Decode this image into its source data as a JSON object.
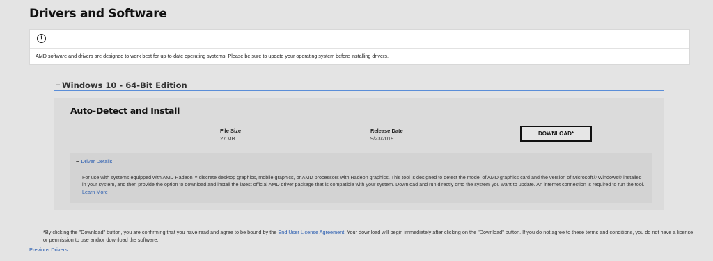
{
  "page": {
    "title": "Drivers and Software"
  },
  "notice": {
    "icon": "exclamation-circle-icon",
    "text": "AMD software and drivers are designed to work best for up-to-date operating systems. Please be sure to update your operating system before installing drivers."
  },
  "os_section": {
    "toggle": "−",
    "title": "Windows 10 - 64-Bit Edition"
  },
  "auto_detect": {
    "title": "Auto-Detect and Install",
    "file_size_label": "File Size",
    "file_size_value": "27 MB",
    "release_date_label": "Release Date",
    "release_date_value": "9/23/2019",
    "download_label": "DOWNLOAD*"
  },
  "driver_details": {
    "toggle": "−",
    "label": "Driver Details",
    "description": "For use with systems equipped with AMD Radeon™ discrete desktop graphics, mobile graphics, or AMD processors with Radeon graphics. This tool is designed to detect the model of AMD graphics card and the version of Microsoft® Windows® installed in your system, and then provide the option to download and install the latest official AMD driver package that is compatible with your system. Download and run directly onto the system you want to update. An internet connection is required to run the tool.",
    "learn_more": "Learn More"
  },
  "footnote": {
    "part1": "*By clicking the \"Download\" button, you are confirming that you have read and agree to be bound by the ",
    "eula_link": "End User License Agreement",
    "part2": ". Your download will begin immediately after clicking on the \"Download\" button. If you do not agree to these terms and conditions, you do not have a license or permission to use and/or download the software."
  },
  "previous_drivers": "Previous Drivers"
}
